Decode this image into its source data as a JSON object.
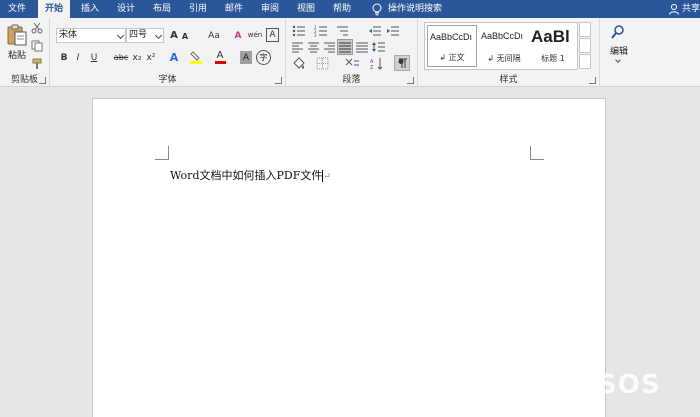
{
  "tabs": [
    {
      "label": "文件"
    },
    {
      "label": "开始"
    },
    {
      "label": "插入"
    },
    {
      "label": "设计"
    },
    {
      "label": "布局"
    },
    {
      "label": "引用"
    },
    {
      "label": "邮件"
    },
    {
      "label": "审阅"
    },
    {
      "label": "视图"
    },
    {
      "label": "帮助"
    }
  ],
  "tell_me": "操作说明搜索",
  "share": "共享",
  "clipboard": {
    "paste_label": "粘贴",
    "group_label": "剪贴板"
  },
  "font": {
    "name": "宋体",
    "size": "四号",
    "case_label": "Aa",
    "phonetic_label": "wén",
    "border_char_label": "A",
    "bold": "B",
    "italic": "I",
    "underline": "U",
    "strike": "abc",
    "subscript": "x₂",
    "superscript": "x²",
    "effects": "A",
    "highlight_color": "#ffff00",
    "font_color_label": "A",
    "font_color": "#e00000",
    "shading": "A",
    "circle_char": "字",
    "group_label": "字体"
  },
  "paragraph": {
    "group_label": "段落"
  },
  "styles": {
    "items": [
      {
        "sample": "AaBbCcDı",
        "name": "↲ 正文"
      },
      {
        "sample": "AaBbCcDı",
        "name": "↲ 无间隔"
      },
      {
        "sample": "AaBl",
        "name": "标题 1"
      }
    ],
    "group_label": "样式"
  },
  "editing": {
    "label": "编辑"
  },
  "document": {
    "text": "Word文档中如何插入PDF文件",
    "paragraph_mark": "↵"
  },
  "watermark": {
    "text": "软件SOS"
  }
}
